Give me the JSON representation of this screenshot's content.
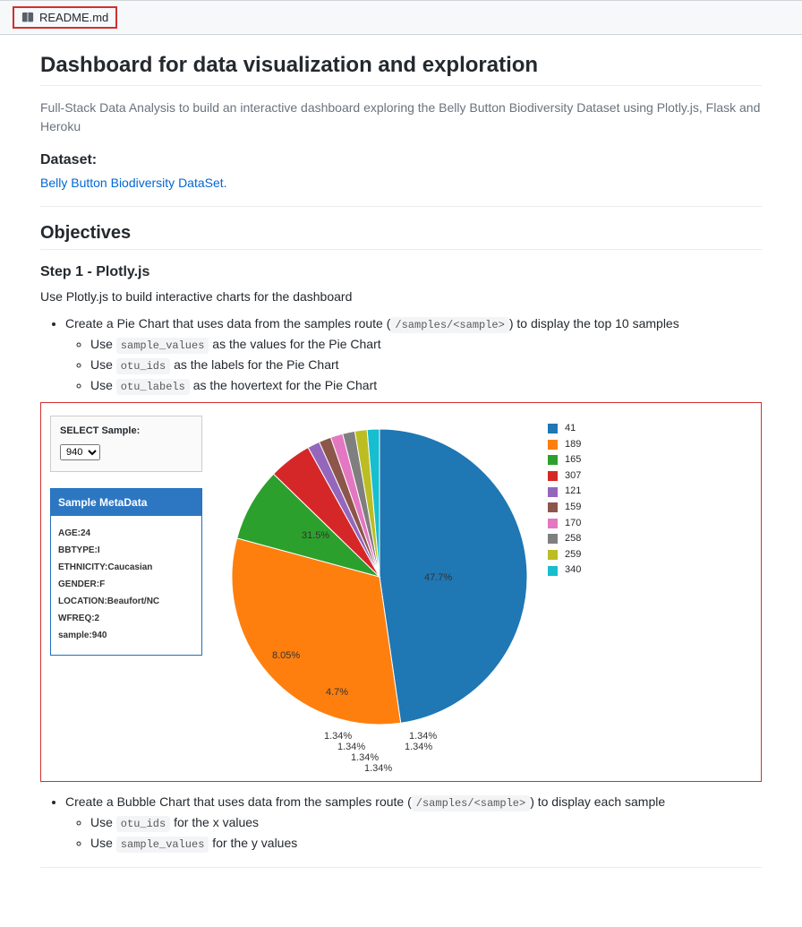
{
  "file_tab": "README.md",
  "title": "Dashboard for data visualization and exploration",
  "intro": "Full-Stack Data Analysis to build an interactive dashboard exploring the Belly Button Biodiversity Dataset using Plotly.js, Flask and Heroku",
  "dataset_heading": "Dataset:",
  "dataset_link": "Belly Button Biodiversity DataSet.",
  "objectives_heading": "Objectives",
  "step1_heading": "Step 1 - Plotly.js",
  "step1_intro": "Use Plotly.js to build interactive charts for the dashboard",
  "bullets": {
    "pie_main_pre": "Create a Pie Chart that uses data from the samples route (",
    "pie_main_code": "/samples/<sample>",
    "pie_main_post": ") to display the top 10 samples",
    "pie_sub1_pre": "Use ",
    "pie_sub1_code": "sample_values",
    "pie_sub1_post": " as the values for the Pie Chart",
    "pie_sub2_pre": "Use ",
    "pie_sub2_code": "otu_ids",
    "pie_sub2_post": " as the labels for the Pie Chart",
    "pie_sub3_pre": "Use ",
    "pie_sub3_code": "otu_labels",
    "pie_sub3_post": " as the hovertext for the Pie Chart",
    "bubble_main_pre": "Create a Bubble Chart that uses data from the samples route (",
    "bubble_main_code": "/samples/<sample>",
    "bubble_main_post": ") to display each sample",
    "bubble_sub1_pre": "Use ",
    "bubble_sub1_code": "otu_ids",
    "bubble_sub1_post": " for the x values",
    "bubble_sub2_pre": "Use ",
    "bubble_sub2_code": "sample_values",
    "bubble_sub2_post": " for the y values"
  },
  "sample_select": {
    "label": "SELECT Sample:",
    "value": "940"
  },
  "metadata": {
    "heading": "Sample MetaData",
    "rows": [
      "AGE:24",
      "BBTYPE:I",
      "ETHNICITY:Caucasian",
      "GENDER:F",
      "LOCATION:Beaufort/NC",
      "WFREQ:2",
      "sample:940"
    ]
  },
  "chart_data": {
    "type": "pie",
    "title": "",
    "series": [
      {
        "label": "41",
        "value": 47.7,
        "color": "#1f77b4"
      },
      {
        "label": "189",
        "value": 31.5,
        "color": "#ff7f0e"
      },
      {
        "label": "165",
        "value": 8.05,
        "color": "#2ca02c"
      },
      {
        "label": "307",
        "value": 4.7,
        "color": "#d62728"
      },
      {
        "label": "121",
        "value": 1.34,
        "color": "#9467bd"
      },
      {
        "label": "159",
        "value": 1.34,
        "color": "#8c564b"
      },
      {
        "label": "170",
        "value": 1.34,
        "color": "#e377c2"
      },
      {
        "label": "258",
        "value": 1.34,
        "color": "#7f7f7f"
      },
      {
        "label": "259",
        "value": 1.34,
        "color": "#bcbd22"
      },
      {
        "label": "340",
        "value": 1.34,
        "color": "#17becf"
      }
    ],
    "labels_shown": {
      "41": "47.7%",
      "189": "31.5%",
      "165": "8.05%",
      "307": "4.7%",
      "121": "1.34%",
      "159": "1.34%",
      "170": "1.34%",
      "258": "1.34%",
      "259": "1.34%",
      "340": "1.34%"
    }
  }
}
